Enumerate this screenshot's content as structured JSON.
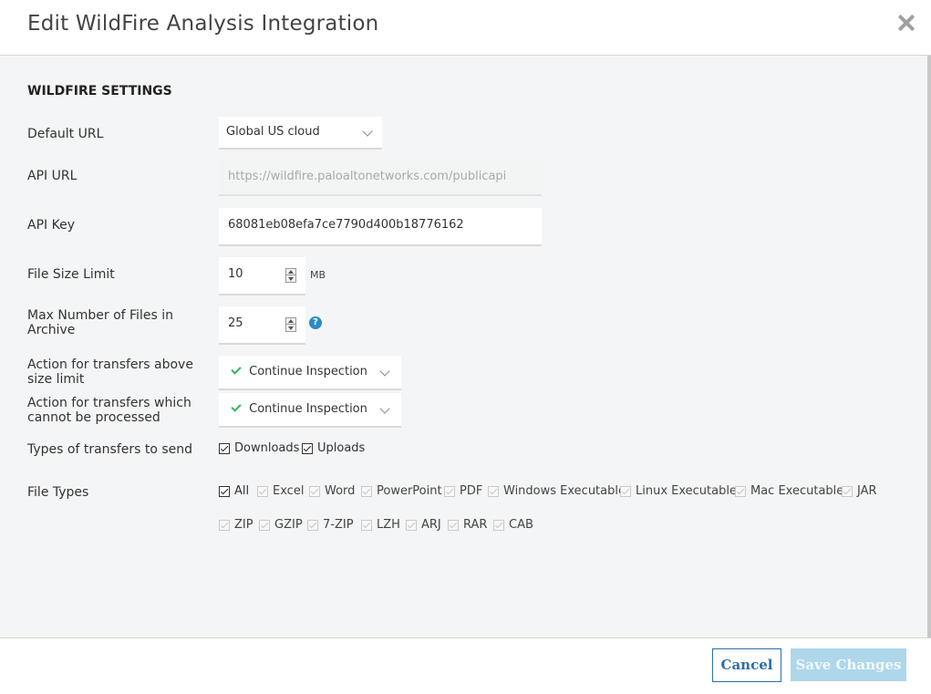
{
  "dialog": {
    "title": "Edit WildFire Analysis Integration"
  },
  "section": {
    "title": "WILDFIRE SETTINGS"
  },
  "fields": {
    "default_url": {
      "label": "Default URL",
      "value": "Global US cloud"
    },
    "api_url": {
      "label": "API URL",
      "value": "https://wildfire.paloaltonetworks.com/publicapi"
    },
    "api_key": {
      "label": "API Key",
      "value": "68081eb08efa7ce7790d400b18776162"
    },
    "file_size_limit": {
      "label": "File Size Limit",
      "value": "10",
      "unit": "MB"
    },
    "max_files": {
      "label": "Max Number of Files in Archive",
      "value": "25"
    },
    "above_size_action": {
      "label": "Action for transfers above size limit",
      "value": "Continue Inspection"
    },
    "unprocessable_action": {
      "label": "Action for transfers which cannot be processed",
      "value": "Continue Inspection"
    },
    "transfer_types": {
      "label": "Types of transfers to send",
      "options": [
        {
          "label": "Downloads",
          "checked": true
        },
        {
          "label": "Uploads",
          "checked": true
        }
      ]
    },
    "file_types": {
      "label": "File Types",
      "row1": [
        "All",
        "Excel",
        "Word",
        "PowerPoint",
        "PDF",
        "Windows Executable",
        "Linux Executable",
        "Mac Executable",
        "JAR"
      ],
      "row2": [
        "ZIP",
        "GZIP",
        "7-ZIP",
        "LZH",
        "ARJ",
        "RAR",
        "CAB"
      ]
    }
  },
  "icons": {
    "close": "close-icon",
    "help": "help-icon",
    "help_glyph": "?"
  },
  "footer": {
    "cancel_label": "Cancel",
    "save_label": "Save Changes"
  },
  "colors": {
    "accent": "#2b6fa8",
    "save_disabled": "#aed7ea",
    "check_green": "#2fb562",
    "help_blue": "#2b8cc4"
  }
}
